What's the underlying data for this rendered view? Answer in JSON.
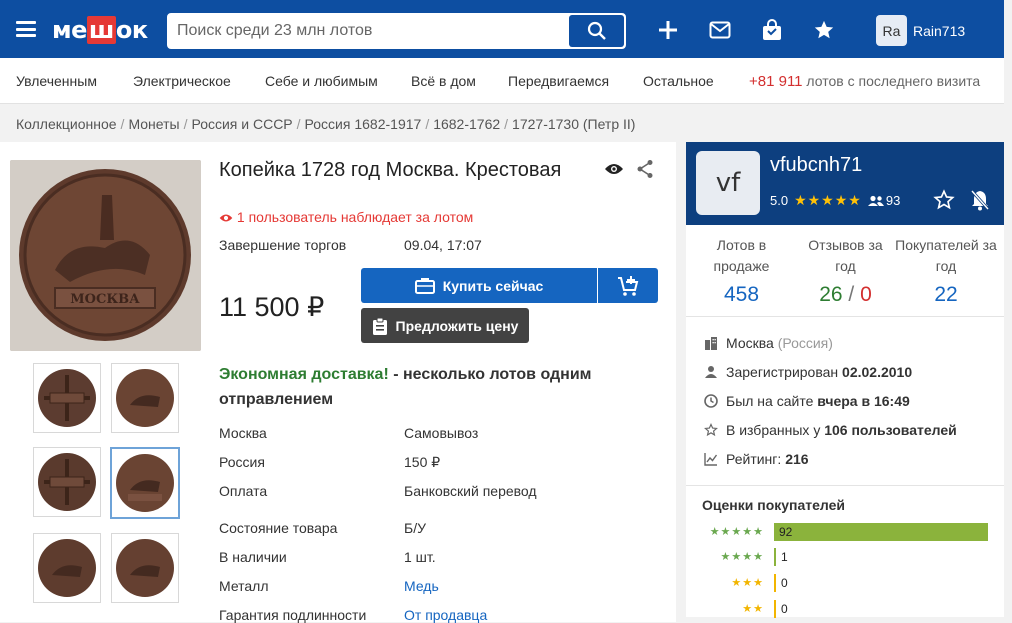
{
  "header": {
    "logo_a": "ме",
    "logo_b": "ш",
    "logo_c": "ок",
    "search_placeholder": "Поиск среди 23 млн лотов",
    "user_initials": "Ra",
    "username": "Rain713",
    "icons": [
      "menu-icon",
      "search-icon",
      "plus-icon",
      "mail-icon",
      "bag-icon",
      "star-icon"
    ]
  },
  "categories": [
    "Увлеченным",
    "Электрическое",
    "Себе и любимым",
    "Всё в дом",
    "Передвигаемся",
    "Остальное"
  ],
  "visits": {
    "count": "+81 911",
    "text": "лотов с последнего визита"
  },
  "breadcrumbs": [
    "Коллекционное",
    "Монеты",
    "Россия и СССР",
    "Россия 1682-1917",
    "1682-1762",
    "1727-1730 (Петр II)"
  ],
  "lot": {
    "title": "Копейка 1728 год Москва. Крестовая",
    "watchers": "1 пользователь наблюдает за лотом",
    "end_label": "Завершение торгов",
    "end_value": "09.04, 17:07",
    "price": "11 500 ₽",
    "buy_label": "Купить сейчас",
    "offer_label": "Предложить цену",
    "delivery_green": "Экономная доставка!",
    "delivery_rest": " - несколько лотов одним отправлением",
    "rows": [
      {
        "label": "Москва",
        "value": "Самовывоз"
      },
      {
        "label": "Россия",
        "value": "150 ₽"
      },
      {
        "label": "Оплата",
        "value": "Банковский перевод"
      },
      {
        "label": "Состояние товара",
        "value": "Б/У"
      },
      {
        "label": "В наличии",
        "value": "1 шт."
      },
      {
        "label": "Металл",
        "value": "Медь"
      },
      {
        "label": "Гарантия подлинности",
        "value": "От продавца"
      }
    ]
  },
  "seller": {
    "initials": "vf",
    "name": "vfubcnh71",
    "rating": "5.0",
    "stars": "★★★★★",
    "followers": "93",
    "stats": [
      {
        "label": "Лотов в продаже",
        "value": "458"
      },
      {
        "label": "Отзывов за год",
        "positive": "26",
        "slash": " / ",
        "negative": "0"
      },
      {
        "label": "Покупателей за год",
        "value": "22"
      }
    ],
    "city": "Москва",
    "country": "(Россия)",
    "registered_label": "Зарегистрирован ",
    "registered_value": "02.02.2010",
    "online_label": "Был на сайте ",
    "online_value": "вчера в 16:49",
    "fav_label": "В избранных у ",
    "fav_value": "106 пользователей",
    "rank_label": "Рейтинг: ",
    "rank_value": "216"
  },
  "buyer_ratings": {
    "title": "Оценки покупателей",
    "rows": [
      {
        "stars": "★★★★★",
        "count": "92"
      },
      {
        "stars": "★★★★",
        "count": "1"
      },
      {
        "stars": "★★★",
        "count": "0"
      },
      {
        "stars": "★★",
        "count": "0"
      }
    ]
  },
  "colors": {
    "brand": "#0d4ea1",
    "seller_header": "#0d3f7f",
    "accent_red": "#e53935",
    "buy_blue": "#1565c0",
    "green": "#2e7d32"
  }
}
